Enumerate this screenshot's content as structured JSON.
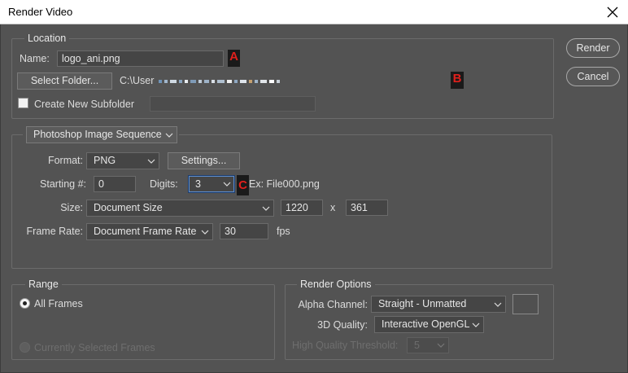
{
  "window": {
    "title": "Render Video"
  },
  "buttons": {
    "render": "Render",
    "cancel": "Cancel"
  },
  "location": {
    "group_label": "Location",
    "name_label": "Name:",
    "name_value": "logo_ani.png",
    "select_folder": "Select Folder...",
    "folder_path_visible": "C:\\User",
    "create_subfolder": "Create New Subfolder",
    "create_subfolder_checked": false,
    "subfolder_value": ""
  },
  "markers": {
    "a": "A",
    "b": "B",
    "c": "C"
  },
  "sequence": {
    "type": "Photoshop Image Sequence",
    "format_label": "Format:",
    "format": "PNG",
    "settings": "Settings...",
    "starting_label": "Starting #:",
    "starting_value": "0",
    "digits_label": "Digits:",
    "digits_value": "3",
    "example": "Ex: File000.png",
    "size_label": "Size:",
    "size": "Document Size",
    "width": "1220",
    "x_sep": "x",
    "height": "361",
    "framerate_label": "Frame Rate:",
    "framerate": "Document Frame Rate",
    "fps_value": "30",
    "fps_unit": "fps"
  },
  "range": {
    "group_label": "Range",
    "all_frames": "All Frames",
    "all_frames_selected": true,
    "selected_frames": "Currently Selected Frames"
  },
  "render_options": {
    "group_label": "Render Options",
    "alpha_label": "Alpha Channel:",
    "alpha": "Straight - Unmatted",
    "quality_label": "3D Quality:",
    "quality": "Interactive OpenGL",
    "threshold_label": "High Quality Threshold:",
    "threshold": "5"
  },
  "colors": {
    "dialog_bg": "#535353",
    "field_bg": "#454545",
    "marker_red": "#e0201c"
  }
}
